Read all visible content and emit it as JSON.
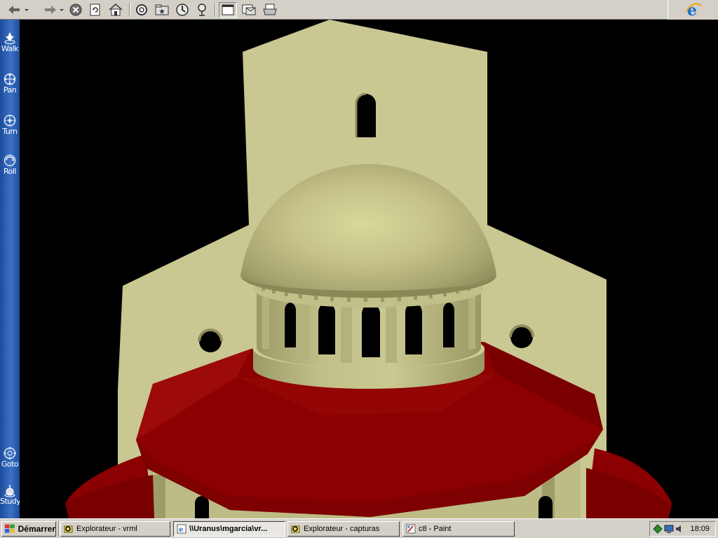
{
  "toolbar": {
    "icons": [
      "back-arrow-icon",
      "forward-arrow-icon",
      "stop-icon",
      "refresh-icon",
      "home-icon",
      "search-icon",
      "favorites-icon",
      "history-icon",
      "channels-icon",
      "fullscreen-icon",
      "mail-icon",
      "print-icon"
    ]
  },
  "sidebar": {
    "items": [
      {
        "label": "Walk"
      },
      {
        "label": "Pan"
      },
      {
        "label": "Turn"
      },
      {
        "label": "Roll"
      },
      {
        "label": "Goto"
      },
      {
        "label": "Study"
      }
    ]
  },
  "scene": {
    "colors": {
      "stone": "#c9c792",
      "stone_dark": "#a09e6a",
      "roof": "#8b0000",
      "roof_dark": "#6a0000",
      "background": "#000000"
    }
  },
  "taskbar": {
    "start_label": "Démarrer",
    "tasks": [
      {
        "label": "Explorateur - vrml",
        "active": false
      },
      {
        "label": "\\\\Uranus\\mgarcia\\vr...",
        "active": true
      },
      {
        "label": "Explorateur - capturas",
        "active": false
      },
      {
        "label": "c8 - Paint",
        "active": false
      }
    ],
    "clock": "18:09"
  }
}
